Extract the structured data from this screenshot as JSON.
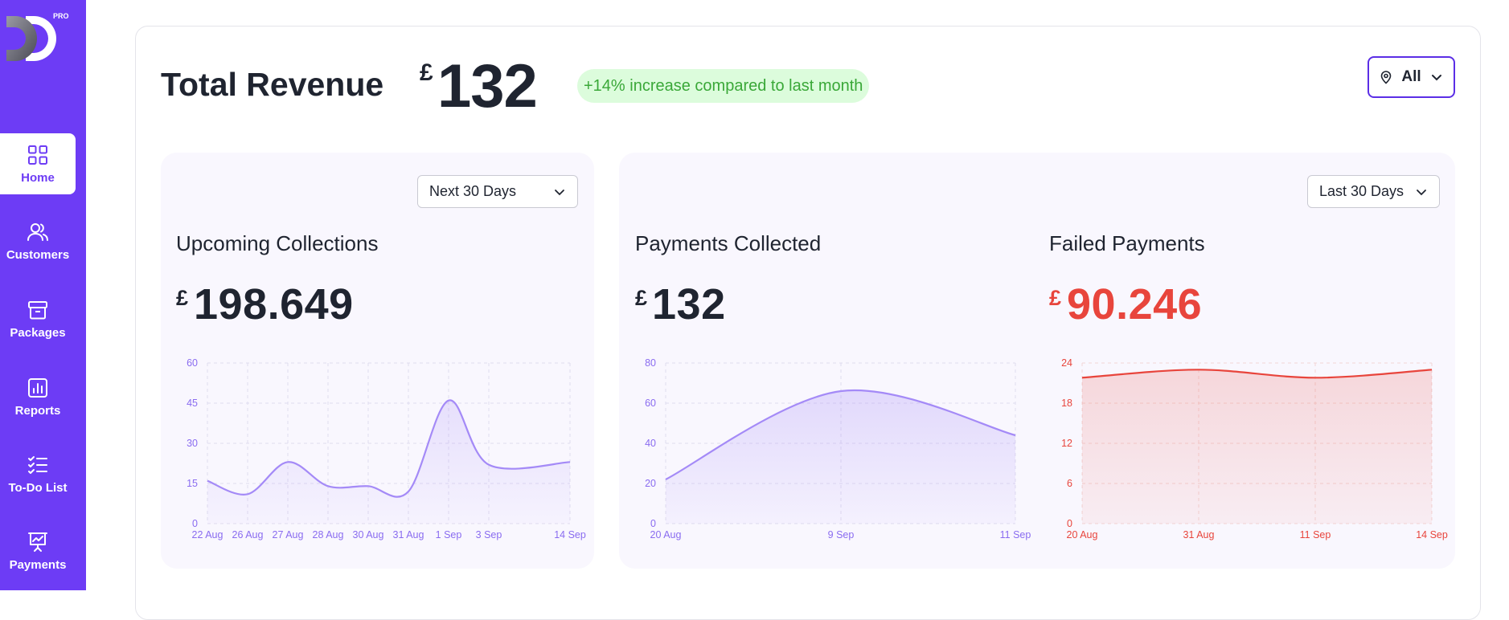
{
  "brand": {
    "badge": "PRO"
  },
  "nav": [
    {
      "label": "Home",
      "icon": "grid-icon",
      "active": true
    },
    {
      "label": "Customers",
      "icon": "users-icon",
      "active": false
    },
    {
      "label": "Packages",
      "icon": "archive-icon",
      "active": false
    },
    {
      "label": "Reports",
      "icon": "bar-chart-icon",
      "active": false
    },
    {
      "label": "To-Do List",
      "icon": "checklist-icon",
      "active": false
    },
    {
      "label": "Payments",
      "icon": "presentation-chart-icon",
      "active": false
    }
  ],
  "header": {
    "title": "Total Revenue",
    "currency": "£",
    "value": "132",
    "badge": "+14% increase compared to last month",
    "location_filter": "All"
  },
  "colors": {
    "accent": "#6d3cf5",
    "purple_line": "#a48af7",
    "red": "#e8453c",
    "green": "#3aa838"
  },
  "panels": {
    "upcoming": {
      "period": "Next 30 Days",
      "title": "Upcoming Collections",
      "currency": "£",
      "value": "198.649"
    },
    "collected": {
      "period": "Last 30 Days",
      "title": "Payments Collected",
      "currency": "£",
      "value": "132"
    },
    "failed": {
      "title": "Failed Payments",
      "currency": "£",
      "value": "90.246"
    }
  },
  "chart_data": [
    {
      "type": "area",
      "x": [
        "22 Aug",
        "26 Aug",
        "27 Aug",
        "28 Aug",
        "30 Aug",
        "31 Aug",
        "1 Sep",
        "3 Sep",
        "14 Sep"
      ],
      "series": [
        {
          "values": [
            16,
            11,
            23,
            14,
            14,
            12,
            46,
            22,
            23
          ]
        }
      ],
      "yticks": [
        0,
        15,
        30,
        45,
        60
      ],
      "ylim": [
        0,
        60
      ],
      "grid": true,
      "color": "#a48af7"
    },
    {
      "type": "area",
      "x": [
        "20 Aug",
        "9 Sep",
        "11 Sep"
      ],
      "series": [
        {
          "values": [
            22,
            66,
            44
          ]
        }
      ],
      "yticks": [
        0,
        20,
        40,
        60,
        80
      ],
      "ylim": [
        0,
        80
      ],
      "grid": true,
      "color": "#a48af7"
    },
    {
      "type": "area",
      "x": [
        "20 Aug",
        "31 Aug",
        "11 Sep",
        "14 Sep"
      ],
      "series": [
        {
          "values": [
            21.8,
            23,
            21.8,
            23
          ]
        }
      ],
      "yticks": [
        0,
        6,
        12,
        18,
        24
      ],
      "ylim": [
        0,
        24
      ],
      "grid": true,
      "color": "#e8453c"
    }
  ]
}
